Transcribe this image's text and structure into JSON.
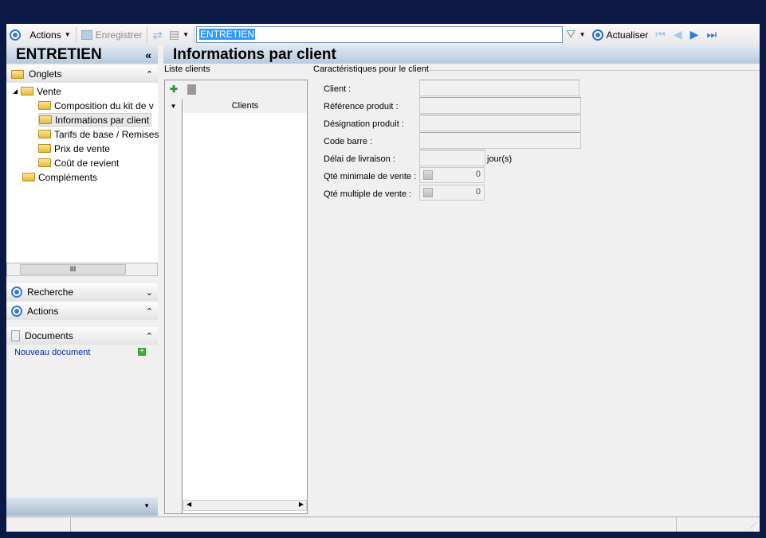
{
  "toolbar": {
    "actions": "Actions",
    "save": "Enregistrer",
    "search_value": "ENTRETIEN",
    "refresh": "Actualiser"
  },
  "sidebar": {
    "title": "ENTRETIEN",
    "collapse": "«",
    "tabs_header": "Onglets",
    "tree": {
      "root": "Vente",
      "children": [
        "Composition du kit de v",
        "Informations par client",
        "Tarifs de base / Remises",
        "Prix de vente",
        "Coût de revient"
      ],
      "other": "Compléments"
    },
    "search": "Recherche",
    "actions": "Actions",
    "documents": "Documents",
    "new_document": "Nouveau document"
  },
  "main": {
    "title": "Informations par client",
    "list_group": "Liste clients",
    "list_column": "Clients",
    "details_group": "Caractéristiques pour le client",
    "fields": {
      "client": "Client :",
      "reference": "Référence produit :",
      "designation": "Désignation produit :",
      "barcode": "Code barre :",
      "delay": "Délai de livraison :",
      "delay_unit": "jour(s)",
      "min_qty": "Qté minimale de vente :",
      "min_qty_value": "0",
      "mult_qty": "Qté multiple de vente :",
      "mult_qty_value": "0"
    }
  }
}
